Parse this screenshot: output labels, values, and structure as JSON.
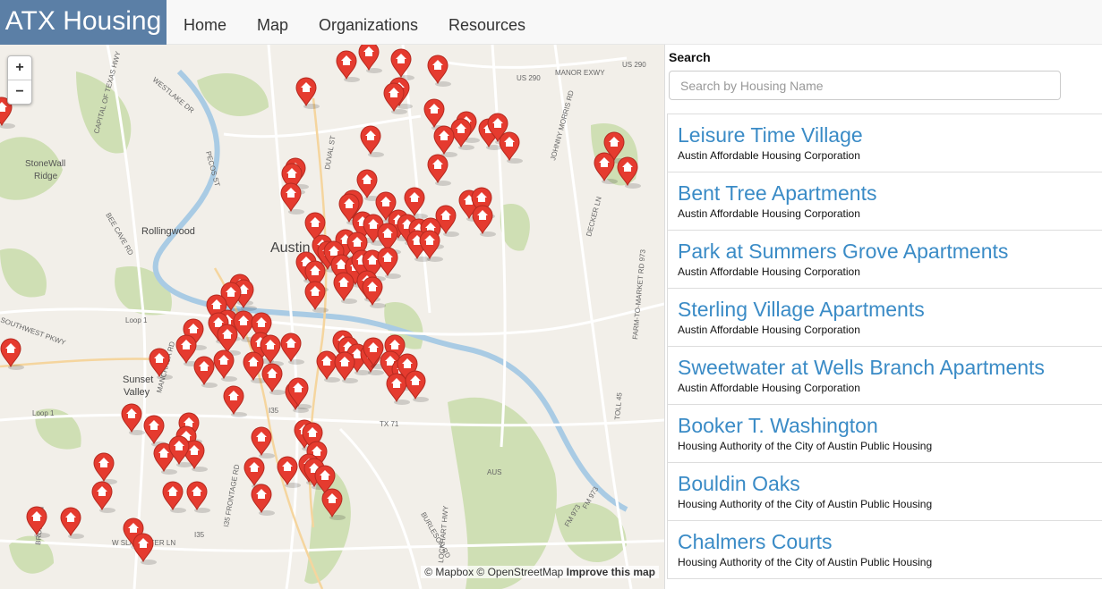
{
  "brand": "ATX Housing",
  "nav": [
    {
      "label": "Home"
    },
    {
      "label": "Map"
    },
    {
      "label": "Organizations"
    },
    {
      "label": "Resources"
    }
  ],
  "map": {
    "zoom_in": "+",
    "zoom_out": "−",
    "labels": [
      "Austin",
      "Rollingwood",
      "StoneWall",
      "Ridge",
      "Sunset",
      "Valley",
      "Loop 1",
      "Loop 1",
      "I35",
      "I35",
      "TX 71",
      "US 290",
      "US 290",
      "MANOR EXWY",
      "AUS",
      "FM 973",
      "FM 973",
      "BURLESON RD",
      "LOCKHART HWY",
      "DECKER LN",
      "PECOS ST",
      "DUVAL ST",
      "BEE CAVE RD",
      "SOUTHWEST PKWY",
      "W SLAUGHTER LN",
      "MANCHACA RD",
      "BRODIE LN",
      "WESTLAKE DR",
      "CAPITAL OF TEXAS HWY",
      "FARM-TO-MARKET RD 973",
      "TOLL 45",
      "JOHNNY MORRIS RD",
      "I35 FRONTAGE RD"
    ],
    "attribution": "© Mapbox © OpenStreetMap",
    "improve_link": "Improve this map",
    "marker_color": "#e53b2f",
    "water_color": "#a9cbe4",
    "park_color": "#cfdfb4"
  },
  "sidebar": {
    "search_label": "Search",
    "search_placeholder": "Search by Housing Name",
    "items": [
      {
        "name": "Leisure Time Village",
        "org": "Austin Affordable Housing Corporation"
      },
      {
        "name": "Bent Tree Apartments",
        "org": "Austin Affordable Housing Corporation"
      },
      {
        "name": "Park at Summers Grove Apartments",
        "org": "Austin Affordable Housing Corporation"
      },
      {
        "name": "Sterling Village Apartments",
        "org": "Austin Affordable Housing Corporation"
      },
      {
        "name": "Sweetwater at Wells Branch Apartments",
        "org": "Austin Affordable Housing Corporation"
      },
      {
        "name": "Booker T. Washington",
        "org": "Housing Authority of the City of Austin Public Housing"
      },
      {
        "name": "Bouldin Oaks",
        "org": "Housing Authority of the City of Austin Public Housing"
      },
      {
        "name": "Chalmers Courts",
        "org": "Housing Authority of the City of Austin Public Housing"
      }
    ]
  }
}
